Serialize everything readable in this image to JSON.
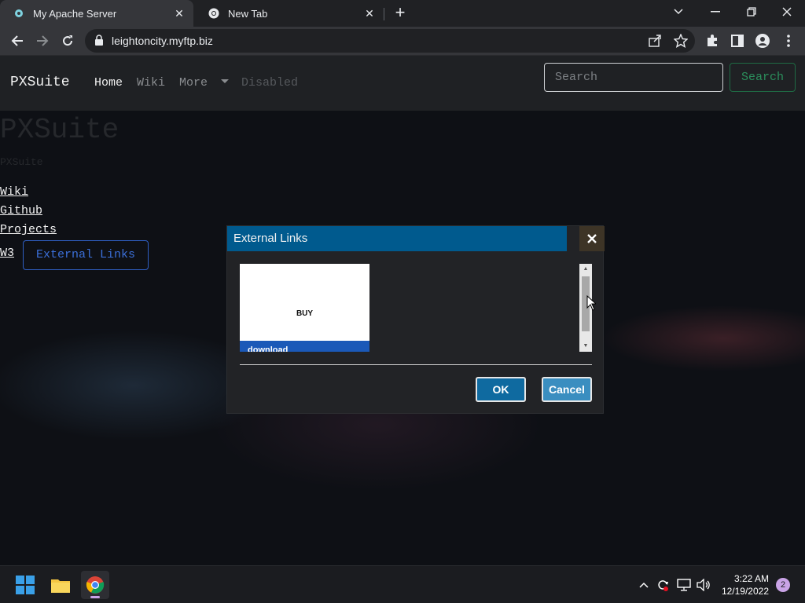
{
  "browser": {
    "tabs": [
      {
        "title": "My Apache Server",
        "active": true
      },
      {
        "title": "New Tab",
        "active": false
      }
    ],
    "url": "leightoncity.myftp.biz"
  },
  "site": {
    "brand": "PXSuite",
    "nav": {
      "home": "Home",
      "wiki": "Wiki",
      "more": "More",
      "disabled": "Disabled"
    },
    "search": {
      "placeholder": "Search",
      "button": "Search"
    },
    "heading": "PXSuite",
    "subheading": "PXSuite",
    "links": [
      "Wiki",
      "Github",
      "Projects",
      "W3"
    ],
    "external_button": "External Links"
  },
  "modal": {
    "title": "External Links",
    "thumb_text": "BUY",
    "thumb_bar_text": "download",
    "ok": "OK",
    "cancel": "Cancel"
  },
  "taskbar": {
    "time": "3:22 AM",
    "date": "12/19/2022",
    "notifications": "2"
  },
  "colors": {
    "modal_header": "#005a8e",
    "ok_button": "#0f6aa0",
    "cancel_button": "#3a8ec0",
    "search_button": "#2b8f5c",
    "external_links_button": "#3b6fd8"
  }
}
